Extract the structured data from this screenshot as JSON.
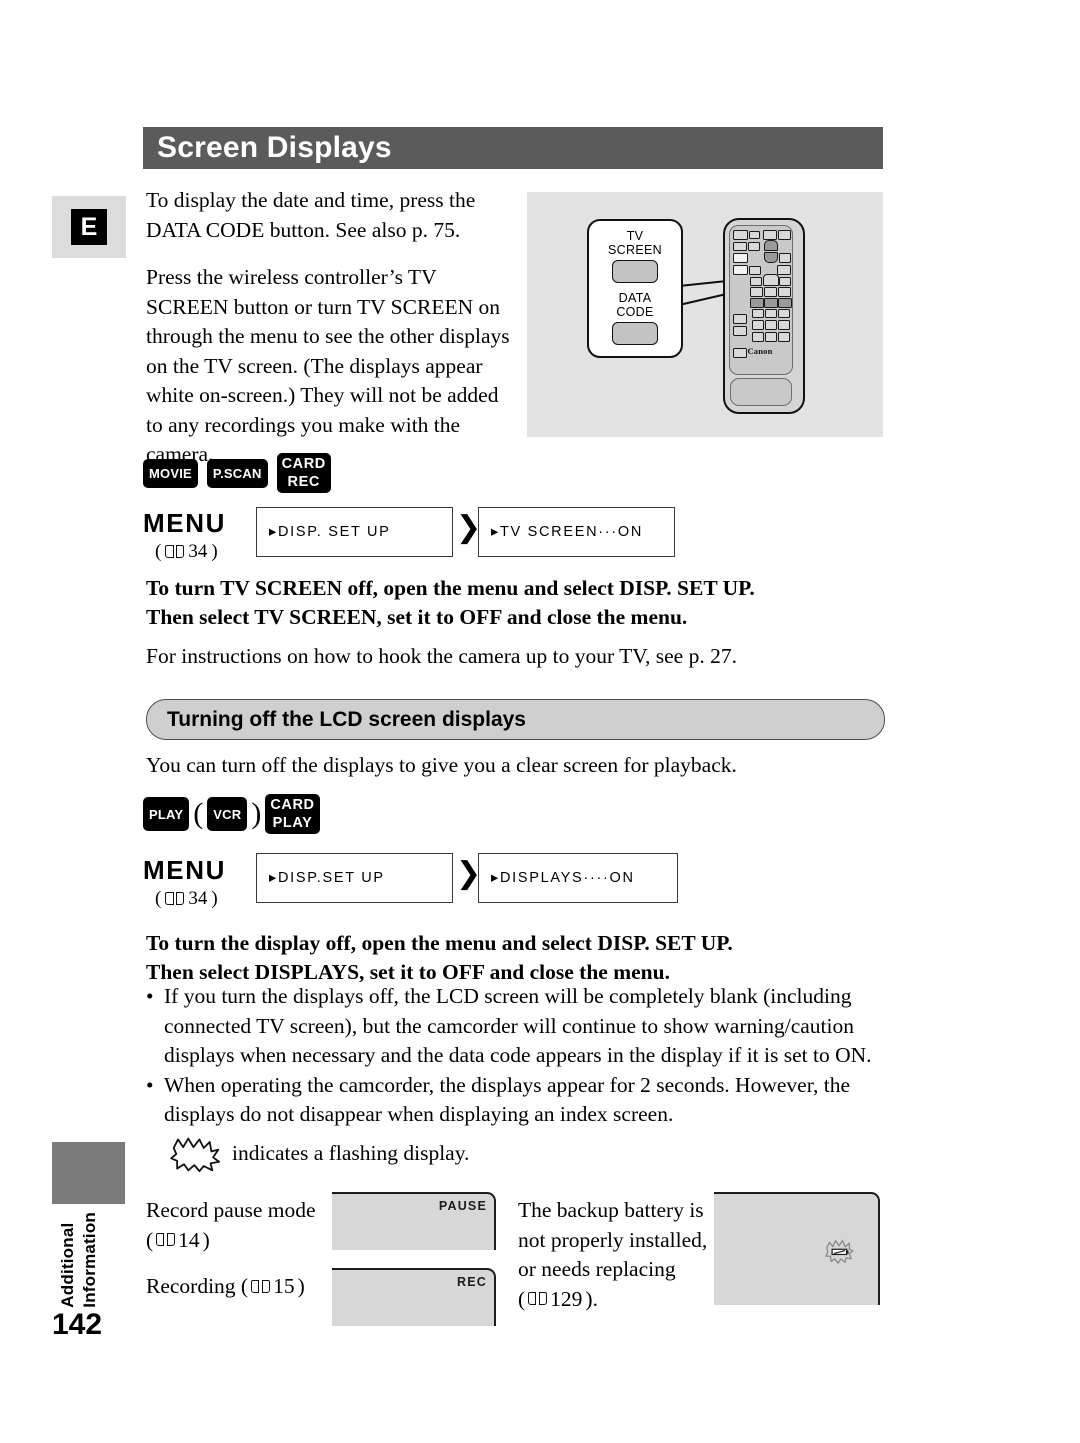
{
  "page": {
    "title": "Screen Displays",
    "language_tab": "E",
    "page_number": "142",
    "section_tab_line1": "Additional",
    "section_tab_line2": "Information"
  },
  "intro": {
    "paragraph_1": "To display the date and time, press the DATA CODE button. See also p. 75.",
    "paragraph_2": "Press the wireless controller’s TV SCREEN button or turn TV SCREEN on through the menu to see the other displays on the TV screen. (The displays appear white on-screen.) They will not be added to any recordings you make with the camera."
  },
  "remote_illustration": {
    "callout_button_1_label_line1": "TV",
    "callout_button_1_label_line2": "SCREEN",
    "callout_button_2_label_line1": "DATA",
    "callout_button_2_label_line2": "CODE",
    "brand": "Canon"
  },
  "tv_screen_section": {
    "badges": [
      {
        "label": "MOVIE",
        "lines": [
          "MOVIE"
        ]
      },
      {
        "label": "P.SCAN",
        "lines": [
          "P.SCAN"
        ]
      },
      {
        "label": "CARD REC",
        "lines": [
          "CARD",
          "REC"
        ]
      }
    ],
    "menu_label": "MENU",
    "menu_ref": "34",
    "menu_ref_open": "(",
    "menu_ref_close": ")",
    "step_1": "▸DISP. SET UP",
    "step_separator": "❯❯",
    "step_2": "▸TV SCREEN···ON",
    "bold_instruction_line1": "To turn TV SCREEN off, open the menu and select DISP. SET UP.",
    "bold_instruction_line2": "Then select TV SCREEN, set it to OFF and close the menu.",
    "note": "For instructions on how to hook the camera up to your TV, see p. 27."
  },
  "lcd_section": {
    "heading": "Turning off the LCD screen displays",
    "intro": "You can turn off the displays to give you a clear screen for playback.",
    "badges": [
      {
        "label": "PLAY",
        "lines": [
          "PLAY"
        ]
      },
      {
        "label": "VCR",
        "lines": [
          "VCR"
        ]
      },
      {
        "label": "CARD PLAY",
        "lines": [
          "CARD",
          "PLAY"
        ]
      }
    ],
    "paren_open": "(",
    "paren_close": ")",
    "menu_label": "MENU",
    "menu_ref": "34",
    "menu_ref_open": "(",
    "menu_ref_close": ")",
    "step_1": "▸DISP.SET UP",
    "step_separator": "❯❯",
    "step_2": "▸DISPLAYS····ON",
    "bold_instruction_line1": "To turn the display off, open the menu and select DISP. SET UP.",
    "bold_instruction_line2": "Then select DISPLAYS, set it to OFF and close the menu.",
    "bullets": [
      "If you turn the displays off, the LCD screen will be completely blank (including connected TV screen), but the camcorder will continue to show warning/caution displays when necessary and the data code appears in the display if it is set to ON.",
      "When operating the camcorder, the displays appear for 2 seconds. However, the displays do not disappear when displaying an index screen."
    ],
    "bullet_marker": "•",
    "flash_note": "indicates a flashing display."
  },
  "display_table": {
    "rows": [
      {
        "description": "Record pause mode",
        "ref_open": "(",
        "ref_page": "14",
        "ref_close": ")",
        "screen_tag": "PAUSE"
      },
      {
        "description": "Recording (",
        "ref_page": "15",
        "ref_close": ")",
        "screen_tag": "REC"
      }
    ],
    "battery_warning": {
      "line1": "The backup battery is",
      "line2": "not properly installed,",
      "line3": "or needs replacing",
      "ref_open": "(",
      "ref_page": "129",
      "ref_close": ")."
    }
  },
  "colors": {
    "title_band": "#5b5b5b",
    "heading_pill": "#cfcfcf",
    "illustration_bg": "#e3e3e3",
    "screen_gray": "#d7d7d7",
    "badge_black": "#000000",
    "footer_tab": "#7b7b7b"
  }
}
